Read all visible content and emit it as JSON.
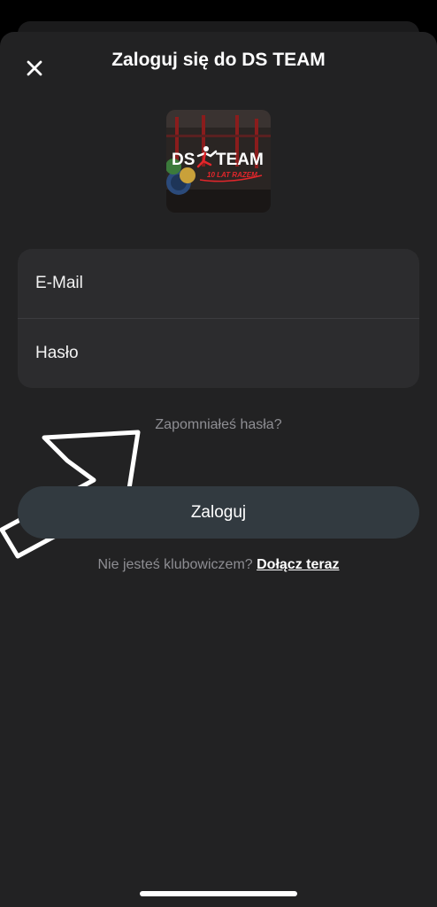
{
  "header": {
    "title": "Zaloguj się do DS TEAM",
    "close_icon": "close-icon"
  },
  "logo": {
    "brand_text_left": "DS",
    "brand_text_right": "TEAM",
    "tagline": "10 LAT RAZEM",
    "accent_color": "#e3262b"
  },
  "form": {
    "email_placeholder": "E-Mail",
    "password_placeholder": "Hasło"
  },
  "links": {
    "forgot_password": "Zapomniałeś hasła?",
    "not_member": "Nie jesteś klubowiczem?",
    "join_now": "Dołącz teraz"
  },
  "buttons": {
    "login_label": "Zaloguj"
  },
  "colors": {
    "background": "#000000",
    "sheet": "#222223",
    "card": "#2c2c2e",
    "button": "#323a40",
    "muted_text": "#8e8e93"
  }
}
